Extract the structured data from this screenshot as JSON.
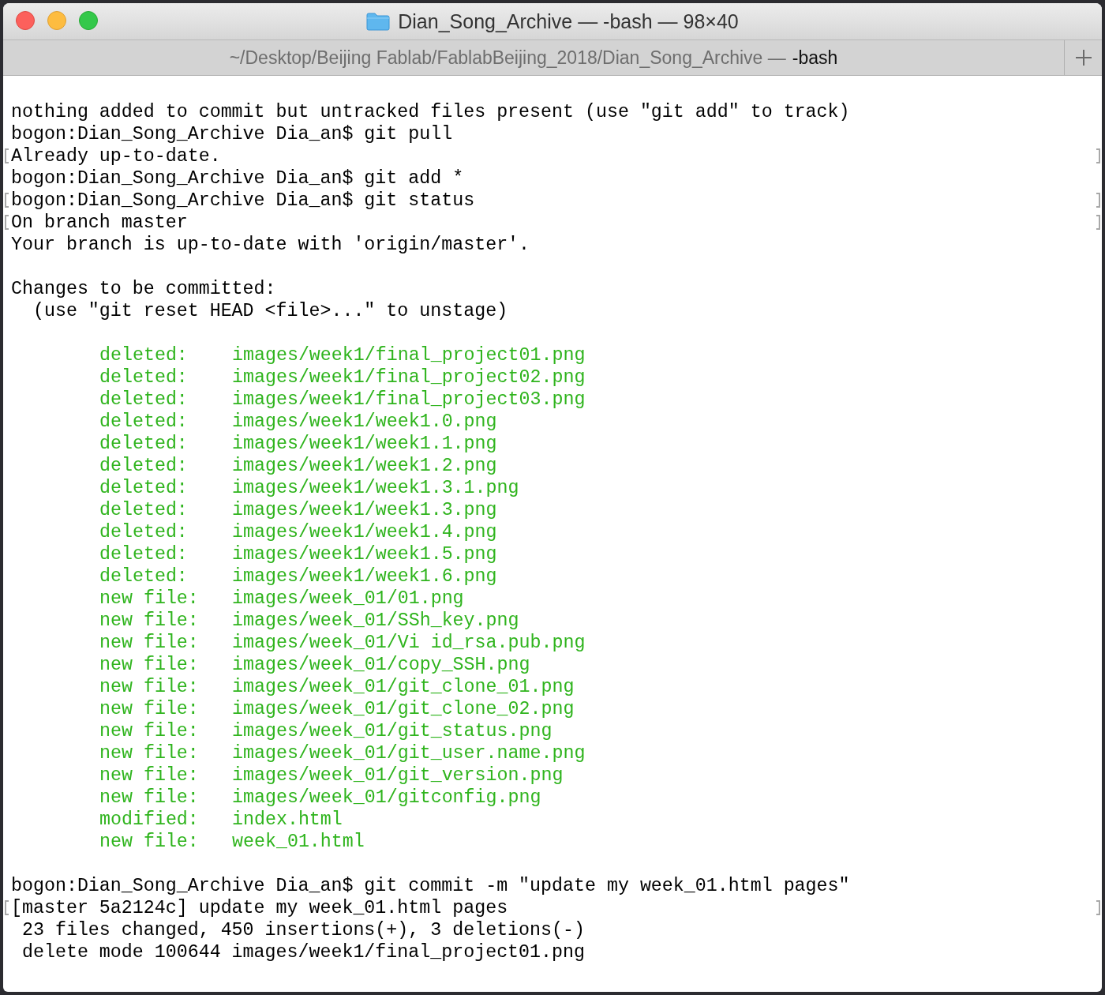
{
  "window": {
    "title": "Dian_Song_Archive — -bash — 98×40"
  },
  "tab": {
    "path": "~/Desktop/Beijing Fablab/FablabBeijing_2018/Dian_Song_Archive —",
    "process": "-bash"
  },
  "lines": [
    {
      "kind": "blank"
    },
    {
      "kind": "text",
      "text": "nothing added to commit but untracked files present (use \"git add\" to track)"
    },
    {
      "kind": "text",
      "text": "bogon:Dian_Song_Archive Dia_an$ git pull"
    },
    {
      "kind": "text",
      "text": "Already up-to-date.",
      "marked": true
    },
    {
      "kind": "text",
      "text": "bogon:Dian_Song_Archive Dia_an$ git add *"
    },
    {
      "kind": "text",
      "text": "bogon:Dian_Song_Archive Dia_an$ git status",
      "marked": true
    },
    {
      "kind": "text",
      "text": "On branch master",
      "marked": true
    },
    {
      "kind": "text",
      "text": "Your branch is up-to-date with 'origin/master'."
    },
    {
      "kind": "blank"
    },
    {
      "kind": "text",
      "text": "Changes to be committed:"
    },
    {
      "kind": "text",
      "text": "  (use \"git reset HEAD <file>...\" to unstage)"
    },
    {
      "kind": "blank"
    },
    {
      "kind": "change",
      "status": "deleted:",
      "path": "images/week1/final_project01.png"
    },
    {
      "kind": "change",
      "status": "deleted:",
      "path": "images/week1/final_project02.png"
    },
    {
      "kind": "change",
      "status": "deleted:",
      "path": "images/week1/final_project03.png"
    },
    {
      "kind": "change",
      "status": "deleted:",
      "path": "images/week1/week1.0.png"
    },
    {
      "kind": "change",
      "status": "deleted:",
      "path": "images/week1/week1.1.png"
    },
    {
      "kind": "change",
      "status": "deleted:",
      "path": "images/week1/week1.2.png"
    },
    {
      "kind": "change",
      "status": "deleted:",
      "path": "images/week1/week1.3.1.png"
    },
    {
      "kind": "change",
      "status": "deleted:",
      "path": "images/week1/week1.3.png"
    },
    {
      "kind": "change",
      "status": "deleted:",
      "path": "images/week1/week1.4.png"
    },
    {
      "kind": "change",
      "status": "deleted:",
      "path": "images/week1/week1.5.png"
    },
    {
      "kind": "change",
      "status": "deleted:",
      "path": "images/week1/week1.6.png"
    },
    {
      "kind": "change",
      "status": "new file:",
      "path": "images/week_01/01.png"
    },
    {
      "kind": "change",
      "status": "new file:",
      "path": "images/week_01/SSh_key.png"
    },
    {
      "kind": "change",
      "status": "new file:",
      "path": "images/week_01/Vi id_rsa.pub.png"
    },
    {
      "kind": "change",
      "status": "new file:",
      "path": "images/week_01/copy_SSH.png"
    },
    {
      "kind": "change",
      "status": "new file:",
      "path": "images/week_01/git_clone_01.png"
    },
    {
      "kind": "change",
      "status": "new file:",
      "path": "images/week_01/git_clone_02.png"
    },
    {
      "kind": "change",
      "status": "new file:",
      "path": "images/week_01/git_status.png"
    },
    {
      "kind": "change",
      "status": "new file:",
      "path": "images/week_01/git_user.name.png"
    },
    {
      "kind": "change",
      "status": "new file:",
      "path": "images/week_01/git_version.png"
    },
    {
      "kind": "change",
      "status": "new file:",
      "path": "images/week_01/gitconfig.png"
    },
    {
      "kind": "change",
      "status": "modified:",
      "path": "index.html"
    },
    {
      "kind": "change",
      "status": "new file:",
      "path": "week_01.html"
    },
    {
      "kind": "blank"
    },
    {
      "kind": "text",
      "text": "bogon:Dian_Song_Archive Dia_an$ git commit -m \"update my week_01.html pages\""
    },
    {
      "kind": "text",
      "text": "[master 5a2124c] update my week_01.html pages",
      "marked": true
    },
    {
      "kind": "text",
      "text": " 23 files changed, 450 insertions(+), 3 deletions(-)"
    },
    {
      "kind": "text",
      "text": " delete mode 100644 images/week1/final_project01.png"
    }
  ]
}
